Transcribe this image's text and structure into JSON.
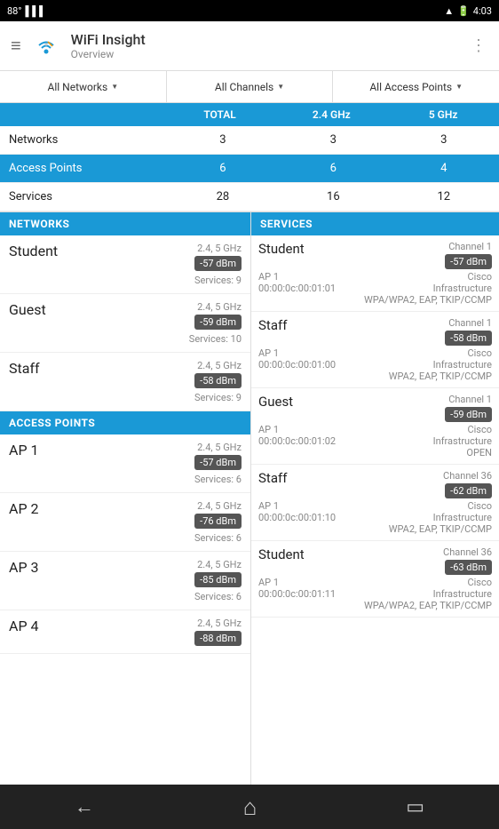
{
  "statusBar": {
    "temp": "88°",
    "time": "4:03"
  },
  "appBar": {
    "title": "WiFi Insight",
    "subtitle": "Overview"
  },
  "filters": {
    "networks": "All Networks",
    "channels": "All Channels",
    "accessPoints": "All Access Points"
  },
  "statsTable": {
    "headers": [
      "",
      "TOTAL",
      "2.4 GHz",
      "5 GHz"
    ],
    "rows": [
      {
        "label": "Networks",
        "total": "3",
        "ghz24": "3",
        "ghz5": "3",
        "highlight": false
      },
      {
        "label": "Access Points",
        "total": "6",
        "ghz24": "6",
        "ghz5": "4",
        "highlight": true
      },
      {
        "label": "Services",
        "total": "28",
        "ghz24": "16",
        "ghz5": "12",
        "highlight": false
      }
    ]
  },
  "sections": {
    "networks": "NETWORKS",
    "accessPoints": "ACCESS POINTS",
    "services": "SERVICES"
  },
  "networks": [
    {
      "name": "Student",
      "bands": "2.4, 5 GHz",
      "signal": "-57 dBm",
      "services": "9"
    },
    {
      "name": "Guest",
      "bands": "2.4, 5 GHz",
      "signal": "-59 dBm",
      "services": "10"
    },
    {
      "name": "Staff",
      "bands": "2.4, 5 GHz",
      "signal": "-58 dBm",
      "services": "9"
    }
  ],
  "accessPoints": [
    {
      "name": "AP 1",
      "bands": "2.4, 5 GHz",
      "signal": "-57 dBm",
      "services": "6"
    },
    {
      "name": "AP 2",
      "bands": "2.4, 5 GHz",
      "signal": "-76 dBm",
      "services": "6"
    },
    {
      "name": "AP 3",
      "bands": "2.4, 5 GHz",
      "signal": "-85 dBm",
      "services": "6"
    },
    {
      "name": "AP 4",
      "bands": "2.4, 5 GHz",
      "signal": "-88 dBm",
      "services": ""
    }
  ],
  "services": [
    {
      "name": "Student",
      "channel": "Channel 1",
      "signal": "-57 dBm",
      "ap": "AP 1",
      "mac": "00:00:0c:00:01:01",
      "vendor": "Cisco",
      "type": "Infrastructure",
      "security": "WPA/WPA2, EAP, TKIP/CCMP"
    },
    {
      "name": "Staff",
      "channel": "Channel 1",
      "signal": "-58 dBm",
      "ap": "AP 1",
      "mac": "00:00:0c:00:01:00",
      "vendor": "Cisco",
      "type": "Infrastructure",
      "security": "WPA2, EAP, TKIP/CCMP"
    },
    {
      "name": "Guest",
      "channel": "Channel 1",
      "signal": "-59 dBm",
      "ap": "AP 1",
      "mac": "00:00:0c:00:01:02",
      "vendor": "Cisco",
      "type": "Infrastructure",
      "security": "OPEN"
    },
    {
      "name": "Staff",
      "channel": "Channel 36",
      "signal": "-62 dBm",
      "ap": "AP 1",
      "mac": "00:00:0c:00:01:10",
      "vendor": "Cisco",
      "type": "Infrastructure",
      "security": "WPA2, EAP, TKIP/CCMP"
    },
    {
      "name": "Student",
      "channel": "Channel 36",
      "signal": "-63 dBm",
      "ap": "AP 1",
      "mac": "00:00:0c:00:01:11",
      "vendor": "Cisco",
      "type": "Infrastructure",
      "security": "WPA/WPA2, EAP, TKIP/CCMP"
    }
  ],
  "bottomNav": {
    "back": "←",
    "home": "⌂",
    "recent": "▭"
  }
}
